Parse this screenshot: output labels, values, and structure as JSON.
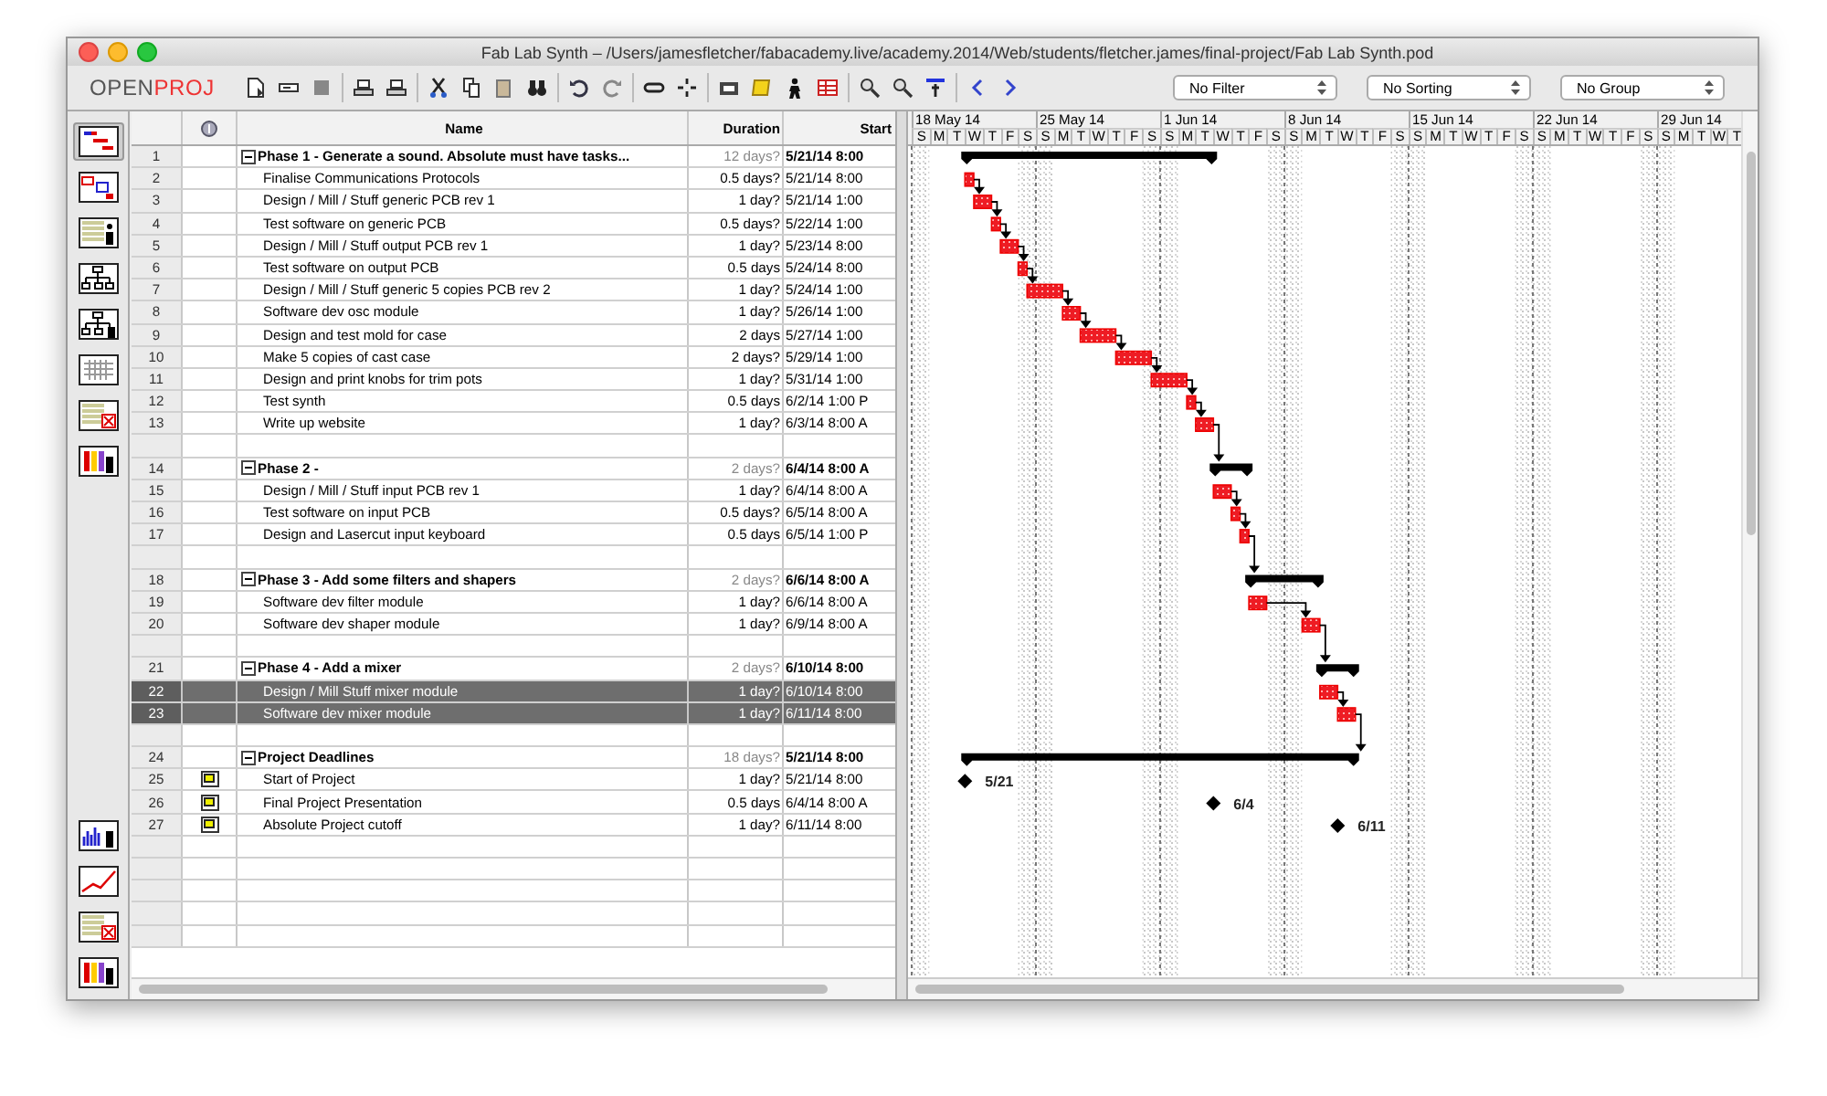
{
  "window": {
    "title": "Fab Lab Synth – /Users/jamesfletcher/fabacademy.live/academy.2014/Web/students/fletcher.james/final-project/Fab Lab Synth.pod"
  },
  "logo": {
    "part_1": "OPEN",
    "part_2": "PROJ"
  },
  "dropdowns": [
    "No Filter",
    "No Sorting",
    "No Group"
  ],
  "views_top": [
    {
      "selected": true
    },
    {
      "selected": false
    },
    {
      "selected": false
    },
    {
      "selected": false
    },
    {
      "selected": false
    },
    {
      "selected": false
    },
    {
      "selected": false
    },
    {
      "selected": false
    }
  ],
  "views_bottom": [
    {
      "selected": false
    },
    {
      "selected": false
    },
    {
      "selected": false
    },
    {
      "selected": false
    }
  ],
  "table": {
    "columns": [
      "Name",
      "Duration",
      "Start"
    ],
    "rows": [
      {
        "kind": "summary",
        "id": "1",
        "expanded": true,
        "name": "Phase 1 - Generate a sound. Absolute must have tasks...",
        "duration": "12 days?",
        "start": "5/21/14 8:00",
        "selected": false
      },
      {
        "kind": "task",
        "id": "2",
        "name": "Finalise Communications Protocols",
        "duration": "0.5 days?",
        "start": "5/21/14 8:00",
        "selected": false
      },
      {
        "kind": "task",
        "id": "3",
        "name": "Design / Mill / Stuff generic PCB rev 1",
        "duration": "1 day?",
        "start": "5/21/14 1:00",
        "selected": false
      },
      {
        "kind": "task",
        "id": "4",
        "name": "Test software on generic PCB",
        "duration": "0.5 days?",
        "start": "5/22/14 1:00",
        "selected": false
      },
      {
        "kind": "task",
        "id": "5",
        "name": "Design / Mill / Stuff output PCB rev 1",
        "duration": "1 day?",
        "start": "5/23/14 8:00",
        "selected": false
      },
      {
        "kind": "task",
        "id": "6",
        "name": "Test software on output PCB",
        "duration": "0.5 days",
        "start": "5/24/14 8:00",
        "selected": false
      },
      {
        "kind": "task",
        "id": "7",
        "name": "Design / Mill / Stuff generic 5 copies PCB rev 2",
        "duration": "1 day?",
        "start": "5/24/14 1:00",
        "selected": false
      },
      {
        "kind": "task",
        "id": "8",
        "name": "Software dev osc module",
        "duration": "1 day?",
        "start": "5/26/14 1:00",
        "selected": false
      },
      {
        "kind": "task",
        "id": "9",
        "name": "Design and test mold for case",
        "duration": "2 days",
        "start": "5/27/14 1:00",
        "selected": false
      },
      {
        "kind": "task",
        "id": "10",
        "name": "Make 5 copies of cast case",
        "duration": "2 days?",
        "start": "5/29/14 1:00",
        "selected": false
      },
      {
        "kind": "task",
        "id": "11",
        "name": "Design and print knobs for trim pots",
        "duration": "1 day?",
        "start": "5/31/14 1:00",
        "selected": false
      },
      {
        "kind": "task",
        "id": "12",
        "name": "Test synth",
        "duration": "0.5 days",
        "start": "6/2/14 1:00 P",
        "selected": false
      },
      {
        "kind": "task",
        "id": "13",
        "name": "Write up website",
        "duration": "1 day?",
        "start": "6/3/14 8:00 A",
        "selected": false
      },
      {
        "kind": "blank",
        "selected": false
      },
      {
        "kind": "summary",
        "id": "14",
        "expanded": true,
        "name": "Phase 2 -",
        "duration": "2 days?",
        "start": "6/4/14 8:00 A",
        "selected": false
      },
      {
        "kind": "task",
        "id": "15",
        "name": "Design / Mill / Stuff input PCB rev 1",
        "duration": "1 day?",
        "start": "6/4/14 8:00 A",
        "selected": false
      },
      {
        "kind": "task",
        "id": "16",
        "name": "Test software on input PCB",
        "duration": "0.5 days?",
        "start": "6/5/14 8:00 A",
        "selected": false
      },
      {
        "kind": "task",
        "id": "17",
        "name": "Design and Lasercut input keyboard",
        "duration": "0.5 days",
        "start": "6/5/14 1:00 P",
        "selected": false
      },
      {
        "kind": "blank",
        "selected": false
      },
      {
        "kind": "summary",
        "id": "18",
        "expanded": true,
        "name": "Phase 3 - Add some filters and shapers",
        "duration": "2 days?",
        "start": "6/6/14 8:00 A",
        "selected": false
      },
      {
        "kind": "task",
        "id": "19",
        "name": "Software dev filter module",
        "duration": "1 day?",
        "start": "6/6/14 8:00 A",
        "selected": false
      },
      {
        "kind": "task",
        "id": "20",
        "name": "Software dev shaper module",
        "duration": "1 day?",
        "start": "6/9/14 8:00 A",
        "selected": false
      },
      {
        "kind": "blank",
        "selected": false
      },
      {
        "kind": "summary",
        "id": "21",
        "expanded": true,
        "name": "Phase 4 - Add a mixer",
        "duration": "2 days?",
        "start": "6/10/14 8:00",
        "selected": false
      },
      {
        "kind": "task",
        "id": "22",
        "name": "Design / Mill Stuff mixer module",
        "duration": "1 day?",
        "start": "6/10/14 8:00",
        "selected": true
      },
      {
        "kind": "task",
        "id": "23",
        "name": "Software dev mixer module",
        "duration": "1 day?",
        "start": "6/11/14 8:00",
        "selected": true
      },
      {
        "kind": "blank",
        "selected": false
      },
      {
        "kind": "summary",
        "id": "24",
        "expanded": true,
        "name": "Project Deadlines",
        "duration": "18 days?",
        "start": "5/21/14 8:00",
        "selected": false
      },
      {
        "kind": "milestone",
        "id": "25",
        "name": "Start of Project",
        "duration": "1 day?",
        "start": "5/21/14 8:00",
        "bar_label": "5/21",
        "selected": false
      },
      {
        "kind": "milestone",
        "id": "26",
        "name": "Final Project Presentation",
        "duration": "0.5 days",
        "start": "6/4/14 8:00 A",
        "bar_label": "6/4",
        "selected": false
      },
      {
        "kind": "milestone",
        "id": "27",
        "name": "Absolute Project cutoff",
        "duration": "1 day?",
        "start": "6/11/14 8:00",
        "bar_label": "6/11",
        "selected": false
      }
    ]
  },
  "timeline": {
    "weeks": [
      {
        "label": "18 May 14",
        "days": [
          "S",
          "M",
          "T",
          "W",
          "T",
          "F",
          "S"
        ]
      },
      {
        "label": "25 May 14",
        "days": [
          "S",
          "M",
          "T",
          "W",
          "T",
          "F",
          "S"
        ]
      },
      {
        "label": "1 Jun 14",
        "days": [
          "S",
          "M",
          "T",
          "W",
          "T",
          "F",
          "S"
        ]
      },
      {
        "label": "8 Jun 14",
        "days": [
          "S",
          "M",
          "T",
          "W",
          "T",
          "F",
          "S"
        ]
      },
      {
        "label": "15 Jun 14",
        "days": [
          "S",
          "M",
          "T",
          "W",
          "T",
          "F",
          "S"
        ]
      },
      {
        "label": "22 Jun 14",
        "days": [
          "S",
          "M",
          "T",
          "W",
          "T",
          "F",
          "S"
        ]
      },
      {
        "label": "29 Jun 14",
        "days": [
          "S",
          "M",
          "T",
          "W",
          "T"
        ]
      }
    ]
  }
}
